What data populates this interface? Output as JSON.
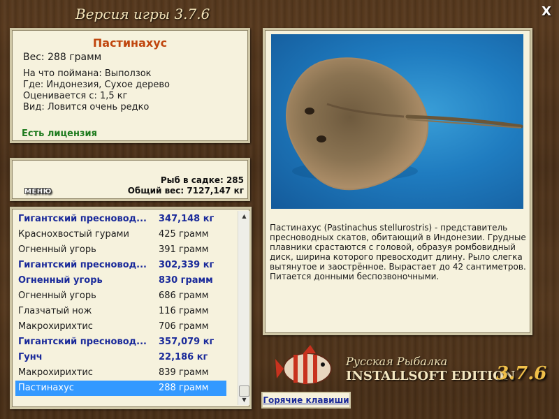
{
  "window": {
    "title": "Версия игры 3.7.6",
    "close_label": "X"
  },
  "fish_info": {
    "name": "Пастинахус",
    "weight_line": "Вес: 288 грамм",
    "caught_on": {
      "label": "На что поймана:",
      "value": "Выползок"
    },
    "location": {
      "label": "Где:",
      "value": "Индонезия, Сухое дерево"
    },
    "valued_from": {
      "label": "Оценивается с:",
      "value": "1,5 кг"
    },
    "kind": {
      "label": "Вид:",
      "value": "Ловится очень редко"
    },
    "license": "Есть лицензия"
  },
  "stats": {
    "menu_label": "МЕНЮ",
    "fish_in_keepnet": "Рыб в садке: 285",
    "total_weight": "Общий вес: 7127,147 кг"
  },
  "catch_list": [
    {
      "name": "Гигантский пресновод...",
      "weight": "347,148 кг",
      "bold": true
    },
    {
      "name": "Краснохвостый гурами",
      "weight": "425 грамм",
      "bold": false
    },
    {
      "name": "Огненный угорь",
      "weight": "391 грамм",
      "bold": false
    },
    {
      "name": "Гигантский пресновод...",
      "weight": "302,339 кг",
      "bold": true
    },
    {
      "name": "Огненный угорь",
      "weight": "830 грамм",
      "bold": true
    },
    {
      "name": "Огненный угорь",
      "weight": "686 грамм",
      "bold": false
    },
    {
      "name": "Глазчатый нож",
      "weight": "116 грамм",
      "bold": false
    },
    {
      "name": "Макрохирихтис",
      "weight": "706 грамм",
      "bold": false
    },
    {
      "name": "Гигантский пресновод...",
      "weight": "357,079 кг",
      "bold": true
    },
    {
      "name": "Гунч",
      "weight": "22,186 кг",
      "bold": true
    },
    {
      "name": "Макрохирихтис",
      "weight": "839 грамм",
      "bold": false
    },
    {
      "name": "Пастинахус",
      "weight": "288 грамм",
      "bold": false,
      "selected": true
    }
  ],
  "description": "Пастинахус (Pastinachus stellurostris) - представитель пресноводных скатов, обитающий в Индонезии. Грудные плавники срастаются с головой, образуя ромбовидный диск, ширина которого превосходит длину. Рыло слегка вытянутое и заострённое. Вырастает до 42 сантиметров. Питается донными беспозвоночными.",
  "logo": {
    "title": "Русская Рыбалка",
    "edition": "INSTALLSOFT EDITION",
    "version": "3.7.6"
  },
  "hotkeys_label": "Горячие клавиши",
  "icons": {
    "close": "close-icon",
    "scroll_up": "scroll-up-icon",
    "scroll_down": "scroll-down-icon",
    "logo_fish": "logo-fish-icon"
  },
  "colors": {
    "fish_name": "#c0460e",
    "license": "#1c7a1c",
    "bold_row": "#1a2a9a",
    "selected_row": "#3399ff",
    "panel_bg": "#f6f2dd"
  }
}
